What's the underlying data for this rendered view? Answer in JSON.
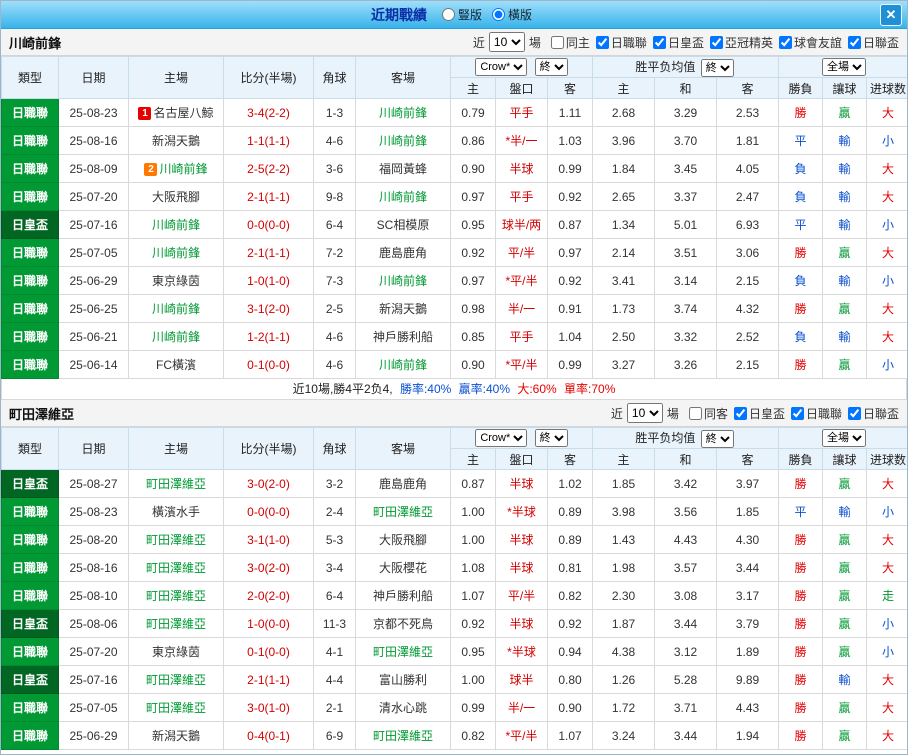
{
  "titlebar": {
    "title": "近期戰績",
    "view_vertical": "豎版",
    "view_horizontal": "橫版",
    "close": "✕"
  },
  "table_header": {
    "type": "類型",
    "date": "日期",
    "home": "主場",
    "score": "比分(半場)",
    "corner": "角球",
    "away": "客場",
    "book_select": "Crow*",
    "final_select": "終",
    "avg_label": "胜平负均值",
    "avg_final_select": "終",
    "scope_select": "全場",
    "sub": [
      "主",
      "盤口",
      "客",
      "主",
      "和",
      "客",
      "勝負",
      "讓球",
      "进球数"
    ]
  },
  "colors": {
    "league_jleague": "#009933",
    "league_cup": "#006622",
    "team_green": "#009933",
    "score_red": "#d40000",
    "win_red": "#e60000",
    "draw_loss_blue": "#0a50d0",
    "cover_green": "#009933"
  },
  "sections": [
    {
      "team": "川崎前鋒",
      "filter": {
        "near": "近",
        "count": "10",
        "unit": "場",
        "checkboxes": [
          {
            "label": "同主",
            "checked": false
          },
          {
            "label": "日職聯",
            "checked": true
          },
          {
            "label": "日皇盃",
            "checked": true
          },
          {
            "label": "亞冠精英",
            "checked": true
          },
          {
            "label": "球會友誼",
            "checked": true
          },
          {
            "label": "日聯盃",
            "checked": true
          }
        ]
      },
      "rows": [
        {
          "league": "日職聯",
          "lc": "jl",
          "date": "25-08-23",
          "badge": [
            "1",
            "red"
          ],
          "home": "名古屋八鯨",
          "score": "3-4(2-2)",
          "corner": "1-3",
          "away": "川崎前鋒",
          "ag": true,
          "o1": "0.79",
          "hc": "平手",
          "o2": "1.11",
          "a1": "2.68",
          "a2": "3.29",
          "a3": "2.53",
          "res": [
            "勝",
            "red"
          ],
          "cov": [
            "贏",
            "green"
          ],
          "gl": [
            "大",
            "red"
          ]
        },
        {
          "league": "日職聯",
          "lc": "jl",
          "date": "25-08-16",
          "home": "新潟天鵝",
          "score": "1-1(1-1)",
          "corner": "4-6",
          "away": "川崎前鋒",
          "ag": true,
          "o1": "0.86",
          "hc": "*半/一",
          "o2": "1.03",
          "a1": "3.96",
          "a2": "3.70",
          "a3": "1.81",
          "res": [
            "平",
            "blue"
          ],
          "cov": [
            "輸",
            "blue"
          ],
          "gl": [
            "小",
            "blue"
          ]
        },
        {
          "league": "日職聯",
          "lc": "jl",
          "date": "25-08-09",
          "badge": [
            "2",
            "orange"
          ],
          "home": "川崎前鋒",
          "hg": true,
          "score": "2-5(2-2)",
          "corner": "3-6",
          "away": "福岡黃蜂",
          "o1": "0.90",
          "hc": "半球",
          "o2": "0.99",
          "a1": "1.84",
          "a2": "3.45",
          "a3": "4.05",
          "res": [
            "負",
            "blue"
          ],
          "cov": [
            "輸",
            "blue"
          ],
          "gl": [
            "大",
            "red"
          ]
        },
        {
          "league": "日職聯",
          "lc": "jl",
          "date": "25-07-20",
          "home": "大阪飛腳",
          "score": "2-1(1-1)",
          "corner": "9-8",
          "away": "川崎前鋒",
          "ag": true,
          "o1": "0.97",
          "hc": "平手",
          "o2": "0.92",
          "a1": "2.65",
          "a2": "3.37",
          "a3": "2.47",
          "res": [
            "負",
            "blue"
          ],
          "cov": [
            "輸",
            "blue"
          ],
          "gl": [
            "大",
            "red"
          ]
        },
        {
          "league": "日皇盃",
          "lc": "cup",
          "date": "25-07-16",
          "home": "川崎前鋒",
          "hg": true,
          "score": "0-0(0-0)",
          "corner": "6-4",
          "away": "SC相模原",
          "o1": "0.95",
          "hc": "球半/两",
          "o2": "0.87",
          "a1": "1.34",
          "a2": "5.01",
          "a3": "6.93",
          "res": [
            "平",
            "blue"
          ],
          "cov": [
            "輸",
            "blue"
          ],
          "gl": [
            "小",
            "blue"
          ]
        },
        {
          "league": "日職聯",
          "lc": "jl",
          "date": "25-07-05",
          "home": "川崎前鋒",
          "hg": true,
          "score": "2-1(1-1)",
          "corner": "7-2",
          "away": "鹿島鹿角",
          "o1": "0.92",
          "hc": "平/半",
          "o2": "0.97",
          "a1": "2.14",
          "a2": "3.51",
          "a3": "3.06",
          "res": [
            "勝",
            "red"
          ],
          "cov": [
            "贏",
            "green"
          ],
          "gl": [
            "大",
            "red"
          ]
        },
        {
          "league": "日職聯",
          "lc": "jl",
          "date": "25-06-29",
          "home": "東京綠茵",
          "score": "1-0(1-0)",
          "corner": "7-3",
          "away": "川崎前鋒",
          "ag": true,
          "o1": "0.97",
          "hc": "*平/半",
          "o2": "0.92",
          "a1": "3.41",
          "a2": "3.14",
          "a3": "2.15",
          "res": [
            "負",
            "blue"
          ],
          "cov": [
            "輸",
            "blue"
          ],
          "gl": [
            "小",
            "blue"
          ]
        },
        {
          "league": "日職聯",
          "lc": "jl",
          "date": "25-06-25",
          "home": "川崎前鋒",
          "hg": true,
          "score": "3-1(2-0)",
          "corner": "2-5",
          "away": "新潟天鵝",
          "o1": "0.98",
          "hc": "半/一",
          "o2": "0.91",
          "a1": "1.73",
          "a2": "3.74",
          "a3": "4.32",
          "res": [
            "勝",
            "red"
          ],
          "cov": [
            "贏",
            "green"
          ],
          "gl": [
            "大",
            "red"
          ]
        },
        {
          "league": "日職聯",
          "lc": "jl",
          "date": "25-06-21",
          "home": "川崎前鋒",
          "hg": true,
          "score": "1-2(1-1)",
          "corner": "4-6",
          "away": "神戶勝利船",
          "o1": "0.85",
          "hc": "平手",
          "o2": "1.04",
          "a1": "2.50",
          "a2": "3.32",
          "a3": "2.52",
          "res": [
            "負",
            "blue"
          ],
          "cov": [
            "輸",
            "blue"
          ],
          "gl": [
            "大",
            "red"
          ]
        },
        {
          "league": "日職聯",
          "lc": "jl",
          "date": "25-06-14",
          "home": "FC橫濱",
          "score": "0-1(0-0)",
          "corner": "4-6",
          "away": "川崎前鋒",
          "ag": true,
          "o1": "0.90",
          "hc": "*平/半",
          "o2": "0.99",
          "a1": "3.27",
          "a2": "3.26",
          "a3": "2.15",
          "res": [
            "勝",
            "red"
          ],
          "cov": [
            "贏",
            "green"
          ],
          "gl": [
            "小",
            "blue"
          ]
        }
      ],
      "summary": [
        {
          "t": "近10場,勝4平2负4, ",
          "c": "dark"
        },
        {
          "t": "勝率:40% ",
          "c": "blue"
        },
        {
          "t": "贏率:40% ",
          "c": "blue"
        },
        {
          "t": "大:60% ",
          "c": "red"
        },
        {
          "t": "單率:70%",
          "c": "red"
        }
      ]
    },
    {
      "team": "町田澤維亞",
      "filter": {
        "near": "近",
        "count": "10",
        "unit": "場",
        "checkboxes": [
          {
            "label": "同客",
            "checked": false
          },
          {
            "label": "日皇盃",
            "checked": true
          },
          {
            "label": "日職聯",
            "checked": true
          },
          {
            "label": "日聯盃",
            "checked": true
          }
        ]
      },
      "rows": [
        {
          "league": "日皇盃",
          "lc": "cup",
          "date": "25-08-27",
          "home": "町田澤維亞",
          "hg": true,
          "score": "3-0(2-0)",
          "corner": "3-2",
          "away": "鹿島鹿角",
          "o1": "0.87",
          "hc": "半球",
          "o2": "1.02",
          "a1": "1.85",
          "a2": "3.42",
          "a3": "3.97",
          "res": [
            "勝",
            "red"
          ],
          "cov": [
            "贏",
            "green"
          ],
          "gl": [
            "大",
            "red"
          ]
        },
        {
          "league": "日職聯",
          "lc": "jl",
          "date": "25-08-23",
          "home": "橫濱水手",
          "score": "0-0(0-0)",
          "corner": "2-4",
          "away": "町田澤維亞",
          "ag": true,
          "o1": "1.00",
          "hc": "*半球",
          "o2": "0.89",
          "a1": "3.98",
          "a2": "3.56",
          "a3": "1.85",
          "res": [
            "平",
            "blue"
          ],
          "cov": [
            "輸",
            "blue"
          ],
          "gl": [
            "小",
            "blue"
          ]
        },
        {
          "league": "日職聯",
          "lc": "jl",
          "date": "25-08-20",
          "home": "町田澤維亞",
          "hg": true,
          "score": "3-1(1-0)",
          "corner": "5-3",
          "away": "大阪飛腳",
          "o1": "1.00",
          "hc": "半球",
          "o2": "0.89",
          "a1": "1.43",
          "a2": "4.43",
          "a3": "4.30",
          "res": [
            "勝",
            "red"
          ],
          "cov": [
            "贏",
            "green"
          ],
          "gl": [
            "大",
            "red"
          ]
        },
        {
          "league": "日職聯",
          "lc": "jl",
          "date": "25-08-16",
          "home": "町田澤維亞",
          "hg": true,
          "score": "3-0(2-0)",
          "corner": "3-4",
          "away": "大阪櫻花",
          "o1": "1.08",
          "hc": "半球",
          "o2": "0.81",
          "a1": "1.98",
          "a2": "3.57",
          "a3": "3.44",
          "res": [
            "勝",
            "red"
          ],
          "cov": [
            "贏",
            "green"
          ],
          "gl": [
            "大",
            "red"
          ]
        },
        {
          "league": "日職聯",
          "lc": "jl",
          "date": "25-08-10",
          "home": "町田澤維亞",
          "hg": true,
          "score": "2-0(2-0)",
          "corner": "6-4",
          "away": "神戶勝利船",
          "o1": "1.07",
          "hc": "平/半",
          "o2": "0.82",
          "a1": "2.30",
          "a2": "3.08",
          "a3": "3.17",
          "res": [
            "勝",
            "red"
          ],
          "cov": [
            "贏",
            "green"
          ],
          "gl": [
            "走",
            "green"
          ]
        },
        {
          "league": "日皇盃",
          "lc": "cup",
          "date": "25-08-06",
          "home": "町田澤維亞",
          "hg": true,
          "score": "1-0(0-0)",
          "corner": "11-3",
          "away": "京都不死鳥",
          "o1": "0.92",
          "hc": "半球",
          "o2": "0.92",
          "a1": "1.87",
          "a2": "3.44",
          "a3": "3.79",
          "res": [
            "勝",
            "red"
          ],
          "cov": [
            "贏",
            "green"
          ],
          "gl": [
            "小",
            "blue"
          ]
        },
        {
          "league": "日職聯",
          "lc": "jl",
          "date": "25-07-20",
          "home": "東京綠茵",
          "score": "0-1(0-0)",
          "corner": "4-1",
          "away": "町田澤維亞",
          "ag": true,
          "o1": "0.95",
          "hc": "*半球",
          "o2": "0.94",
          "a1": "4.38",
          "a2": "3.12",
          "a3": "1.89",
          "res": [
            "勝",
            "red"
          ],
          "cov": [
            "贏",
            "green"
          ],
          "gl": [
            "小",
            "blue"
          ]
        },
        {
          "league": "日皇盃",
          "lc": "cup",
          "date": "25-07-16",
          "home": "町田澤維亞",
          "hg": true,
          "score": "2-1(1-1)",
          "corner": "4-4",
          "away": "富山勝利",
          "o1": "1.00",
          "hc": "球半",
          "o2": "0.80",
          "a1": "1.26",
          "a2": "5.28",
          "a3": "9.89",
          "res": [
            "勝",
            "red"
          ],
          "cov": [
            "輸",
            "blue"
          ],
          "gl": [
            "大",
            "red"
          ]
        },
        {
          "league": "日職聯",
          "lc": "jl",
          "date": "25-07-05",
          "home": "町田澤維亞",
          "hg": true,
          "score": "3-0(1-0)",
          "corner": "2-1",
          "away": "清水心跳",
          "o1": "0.99",
          "hc": "半/一",
          "o2": "0.90",
          "a1": "1.72",
          "a2": "3.71",
          "a3": "4.43",
          "res": [
            "勝",
            "red"
          ],
          "cov": [
            "贏",
            "green"
          ],
          "gl": [
            "大",
            "red"
          ]
        },
        {
          "league": "日職聯",
          "lc": "jl",
          "date": "25-06-29",
          "home": "新潟天鵝",
          "score": "0-4(0-1)",
          "corner": "6-9",
          "away": "町田澤維亞",
          "ag": true,
          "o1": "0.82",
          "hc": "*平/半",
          "o2": "1.07",
          "a1": "3.24",
          "a2": "3.44",
          "a3": "1.94",
          "res": [
            "勝",
            "red"
          ],
          "cov": [
            "贏",
            "green"
          ],
          "gl": [
            "大",
            "red"
          ]
        }
      ],
      "summary": []
    }
  ]
}
